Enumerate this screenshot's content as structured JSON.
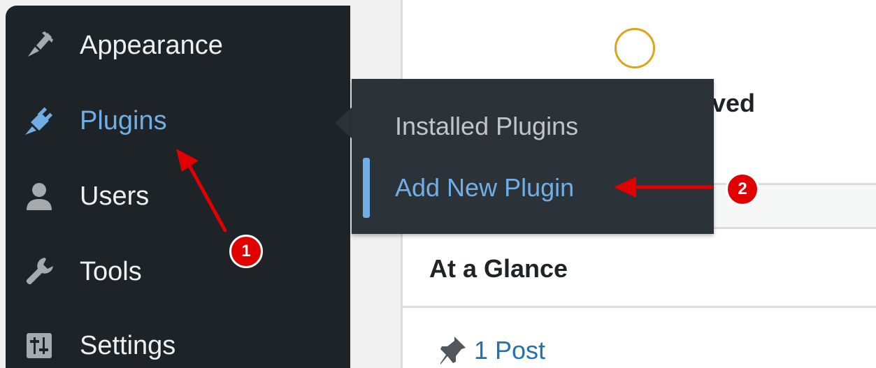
{
  "sidebar": {
    "items": [
      {
        "label": "Appearance",
        "icon": "paintbrush-icon"
      },
      {
        "label": "Plugins",
        "icon": "plugin-icon",
        "current": true
      },
      {
        "label": "Users",
        "icon": "users-icon"
      },
      {
        "label": "Tools",
        "icon": "wrench-icon"
      },
      {
        "label": "Settings",
        "icon": "settings-icon"
      }
    ]
  },
  "flyout": {
    "items": [
      {
        "label": "Installed Plugins"
      },
      {
        "label": "Add New Plugin",
        "active": true
      }
    ]
  },
  "content": {
    "partial_text": "oved",
    "widget_title": "At a Glance",
    "post_count": "1 Post"
  },
  "annotations": {
    "step1": "1",
    "step2": "2"
  },
  "colors": {
    "sidebar_bg": "#1d2327",
    "flyout_bg": "#2c3338",
    "accent_blue": "#72aee6",
    "link_blue": "#2271b1",
    "annotation_red": "#e00000"
  }
}
